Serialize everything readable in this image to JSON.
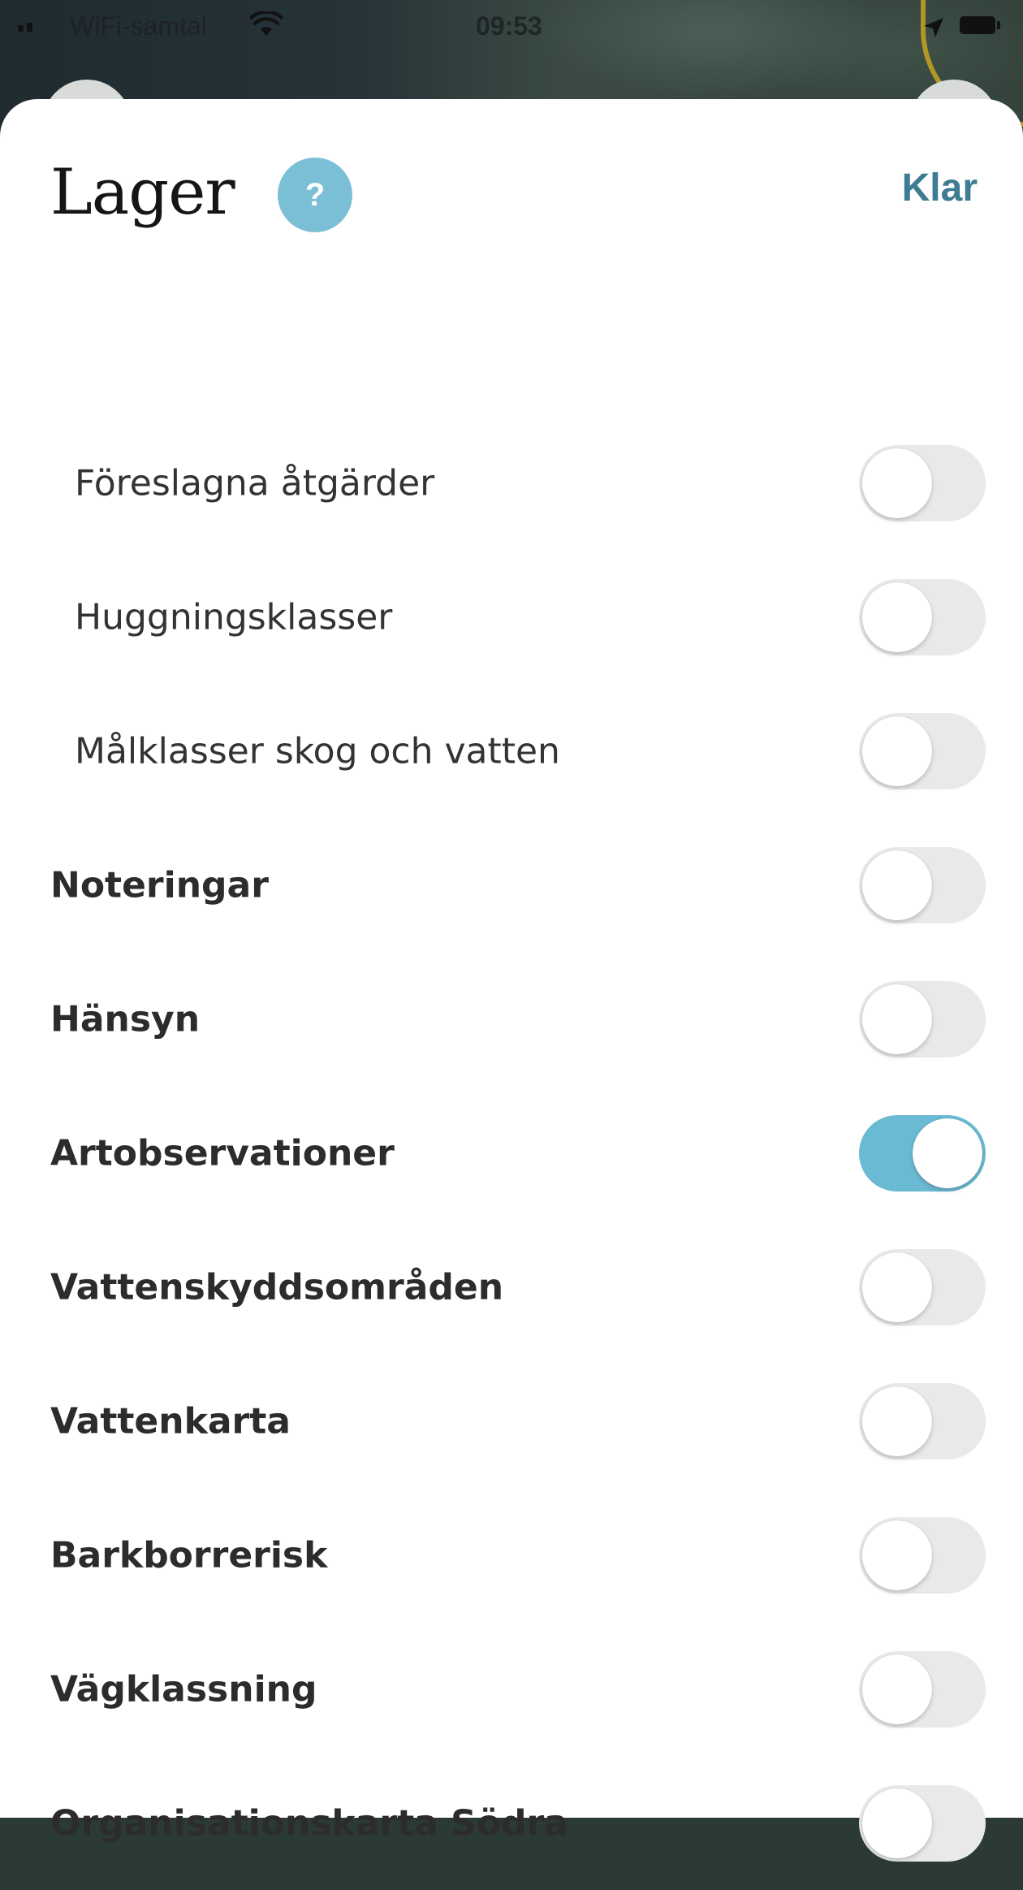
{
  "status_bar": {
    "carrier": "WiFi-samtal",
    "time": "09:53",
    "icons": [
      "signal-icon",
      "wifi-icon",
      "location-arrow-icon",
      "battery-icon"
    ]
  },
  "sheet": {
    "title": "Lager",
    "help_label": "?",
    "done_label": "Klar"
  },
  "colors": {
    "accent": "#6bbad3",
    "help_bg": "#7bbfd6",
    "done_text": "#3d7c93",
    "toggle_off": "#e9e9eb"
  },
  "layers": [
    {
      "label": "Föreslagna åtgärder",
      "level": "sub",
      "enabled": false
    },
    {
      "label": "Huggningsklasser",
      "level": "sub",
      "enabled": false
    },
    {
      "label": "Målklasser skog och vatten",
      "level": "sub",
      "enabled": false
    },
    {
      "label": "Noteringar",
      "level": "main",
      "enabled": false
    },
    {
      "label": "Hänsyn",
      "level": "main",
      "enabled": false
    },
    {
      "label": "Artobservationer",
      "level": "main",
      "enabled": true
    },
    {
      "label": "Vattenskyddsområden",
      "level": "main",
      "enabled": false
    },
    {
      "label": "Vattenkarta",
      "level": "main",
      "enabled": false
    },
    {
      "label": "Barkborrerisk",
      "level": "main",
      "enabled": false
    },
    {
      "label": "Vägklassning",
      "level": "main",
      "enabled": false
    },
    {
      "label": "Organisationskarta Södra",
      "level": "main",
      "enabled": false
    }
  ]
}
